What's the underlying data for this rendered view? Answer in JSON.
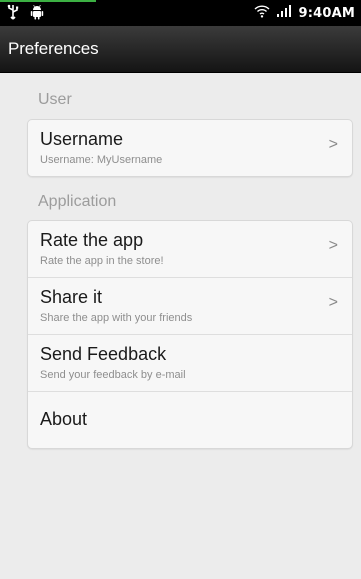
{
  "status_bar": {
    "time": "9:40AM",
    "left_icons": [
      "usb-icon",
      "android-icon"
    ],
    "right_icons": [
      "wifi-icon",
      "signal-icon"
    ]
  },
  "action_bar": {
    "title": "Preferences"
  },
  "sections": [
    {
      "header": "User",
      "items": [
        {
          "title": "Username",
          "summary": "Username: MyUsername",
          "has_chevron": true
        }
      ]
    },
    {
      "header": "Application",
      "items": [
        {
          "title": "Rate the app",
          "summary": "Rate the app in the store!",
          "has_chevron": true
        },
        {
          "title": "Share it",
          "summary": "Share the app with your friends",
          "has_chevron": true
        },
        {
          "title": "Send Feedback",
          "summary": "Send your feedback by e-mail",
          "has_chevron": false
        },
        {
          "title": "About",
          "summary": "",
          "has_chevron": false
        }
      ]
    }
  ],
  "chevron_glyph": ">"
}
